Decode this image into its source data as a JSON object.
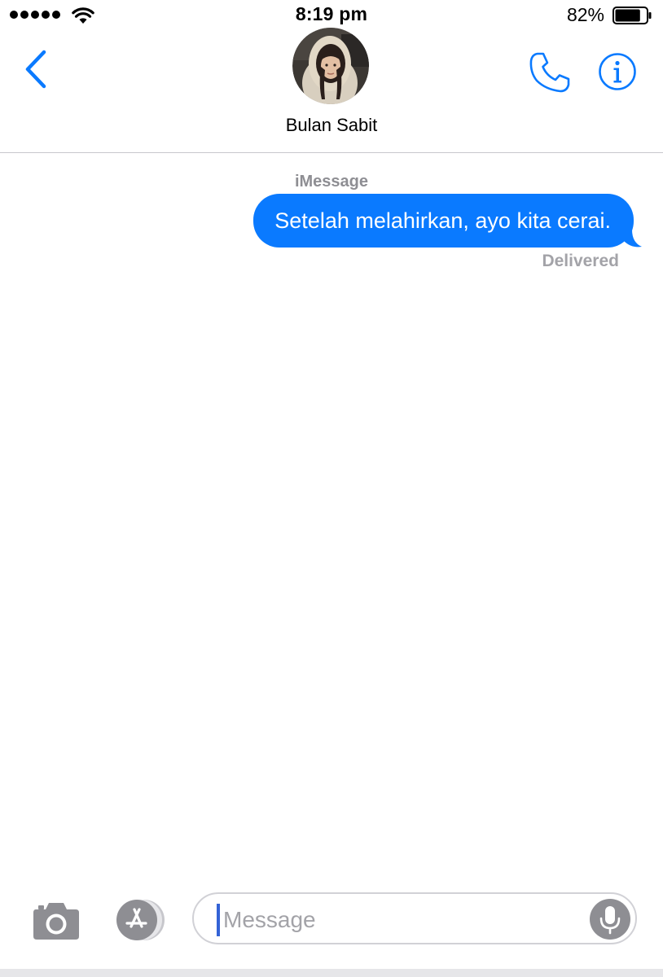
{
  "status_bar": {
    "time": "8:19 pm",
    "battery_percent": "82%",
    "battery_level": 0.82,
    "signal_bars": 5
  },
  "header": {
    "contact_name": "Bulan Sabit",
    "back_icon": "chevron-left-icon",
    "call_icon": "phone-icon",
    "info_icon": "info-icon"
  },
  "conversation": {
    "service_label": "iMessage",
    "messages": [
      {
        "direction": "outgoing",
        "text": "Setelah melahirkan, ayo kita cerai."
      }
    ],
    "status": "Delivered"
  },
  "composer": {
    "placeholder": "Message",
    "value": "",
    "camera_icon": "camera-icon",
    "apps_icon": "app-store-icon",
    "mic_icon": "microphone-icon"
  },
  "colors": {
    "accent": "#0a7aff",
    "bubble_text": "#ffffff",
    "secondary_text": "#8e8e93",
    "divider": "#c8c7cc"
  }
}
